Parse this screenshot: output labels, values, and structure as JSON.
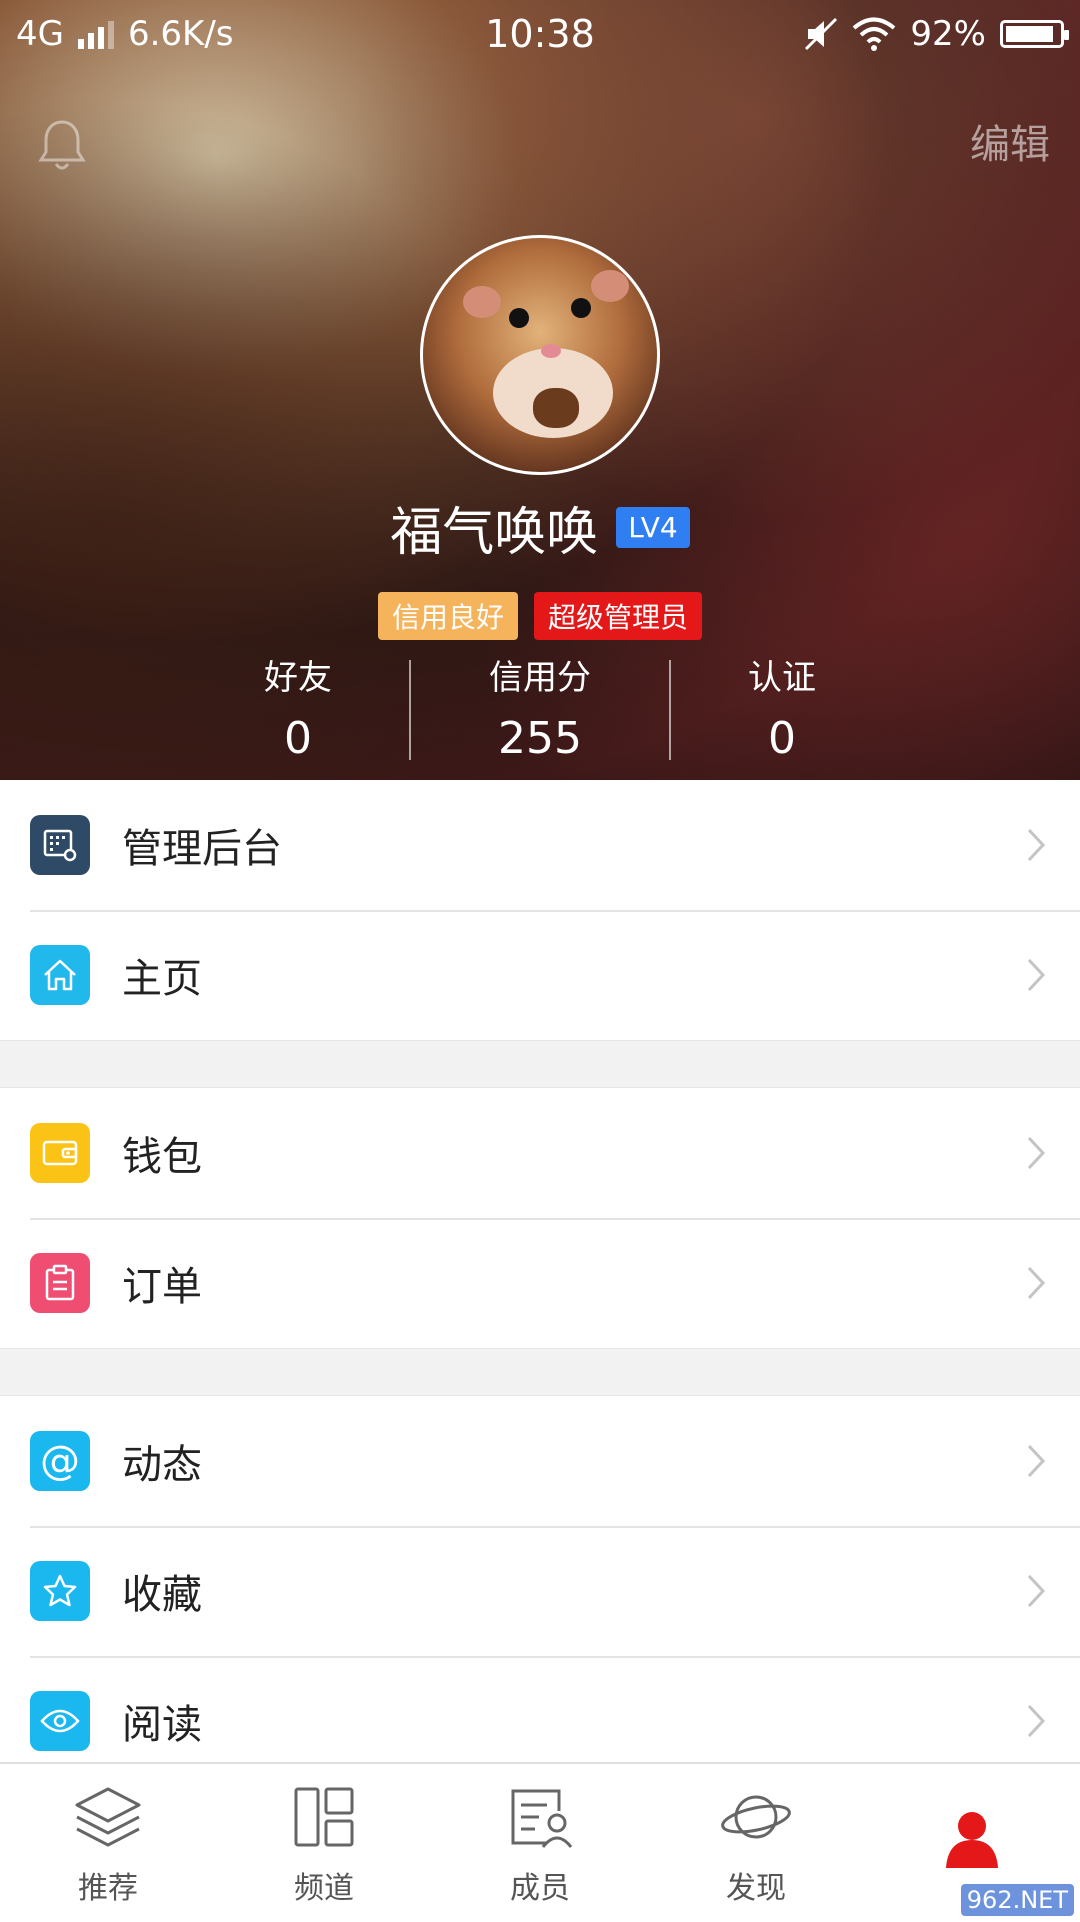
{
  "statusbar": {
    "network": "4G",
    "speed": "6.6K/s",
    "time": "10:38",
    "battery": "92%",
    "battery_level": 0.92
  },
  "header": {
    "edit_label": "编辑",
    "username": "福气唤唤",
    "level": "LV4",
    "tags": [
      "信用良好",
      "超级管理员"
    ],
    "stats": [
      {
        "label": "好友",
        "value": "0"
      },
      {
        "label": "信用分",
        "value": "255"
      },
      {
        "label": "认证",
        "value": "0"
      }
    ]
  },
  "menu": {
    "groups": [
      [
        {
          "label": "管理后台",
          "icon": "admin-panel-icon",
          "color": "#2e4a66"
        },
        {
          "label": "主页",
          "icon": "home-icon",
          "color": "#21b8ec"
        }
      ],
      [
        {
          "label": "钱包",
          "icon": "wallet-icon",
          "color": "#fbc315"
        },
        {
          "label": "订单",
          "icon": "order-icon",
          "color": "#ef4d72"
        }
      ],
      [
        {
          "label": "动态",
          "icon": "at-icon",
          "color": "#1ab8ee"
        },
        {
          "label": "收藏",
          "icon": "star-icon",
          "color": "#1ab8ee"
        },
        {
          "label": "阅读",
          "icon": "eye-icon",
          "color": "#1ab8ee"
        }
      ]
    ]
  },
  "bottom_nav": {
    "items": [
      {
        "label": "推荐",
        "icon": "layers-icon"
      },
      {
        "label": "频道",
        "icon": "grid-icon"
      },
      {
        "label": "成员",
        "icon": "member-card-icon"
      },
      {
        "label": "发现",
        "icon": "planet-icon"
      },
      {
        "label": "",
        "icon": "user-icon",
        "active": true
      }
    ],
    "active_color": "#e41818"
  },
  "watermark": "962.NET"
}
